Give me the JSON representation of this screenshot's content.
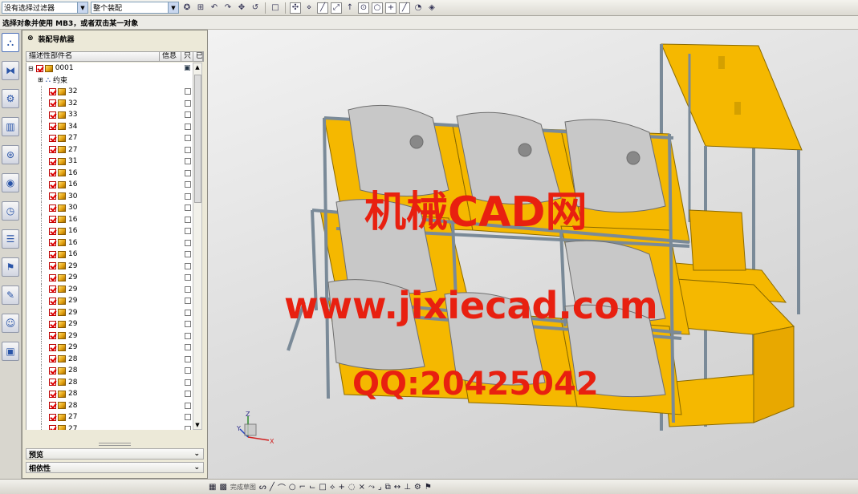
{
  "toolbar": {
    "filter_value": "没有选择过滤器",
    "scope_value": "整个装配",
    "icons": [
      "undo-icon",
      "redo-icon",
      "pan-icon",
      "rotate-icon",
      "zoom-icon",
      "select-box-icon",
      "snap-point-icon",
      "line-icon",
      "arc-icon",
      "perpendicular-icon",
      "circle-icon",
      "plus-icon",
      "diagonal-icon",
      "view-icon"
    ]
  },
  "status": {
    "prompt": "选择对象并使用 MB3，或者双击某一对象"
  },
  "navigator": {
    "title": "装配导航器",
    "columns": [
      "描述性部件名",
      "信息",
      "只",
      "已"
    ],
    "root": "0001",
    "constraints": "约束",
    "items": [
      "32",
      "32",
      "33",
      "34",
      "27",
      "27",
      "31",
      "16",
      "16",
      "30",
      "30",
      "16",
      "16",
      "16",
      "16",
      "29",
      "29",
      "29",
      "29",
      "29",
      "29",
      "29",
      "29",
      "28",
      "28",
      "28",
      "28",
      "28",
      "27",
      "27"
    ],
    "sections": [
      "预览",
      "相依性"
    ]
  },
  "watermark": {
    "line1": "机械CAD网",
    "line2": "www.jixiecad.com",
    "line3": "QQ:20425042"
  },
  "axes": {
    "x": "X",
    "y": "Y",
    "z": "Z"
  },
  "bottom": {
    "finish_sketch": "完成草图"
  },
  "colors": {
    "frame_yellow": "#f5b800",
    "steel": "#7a8a98",
    "car_body": "#c8c8c8",
    "watermark_red": "#e82010"
  }
}
